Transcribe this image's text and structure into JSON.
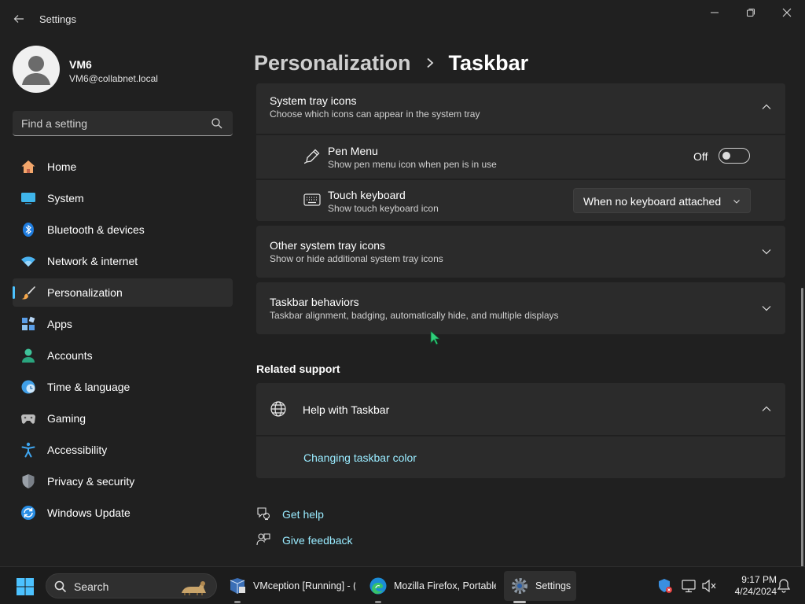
{
  "window": {
    "app_title": "Settings",
    "icons": {
      "back": "arrow-left-icon",
      "minimize": "minimize-icon",
      "maximize": "restore-icon",
      "close": "close-icon"
    }
  },
  "profile": {
    "name": "VM6",
    "email": "VM6@collabnet.local"
  },
  "search": {
    "placeholder": "Find a setting"
  },
  "nav": {
    "items": [
      {
        "label": "Home",
        "icon": "home-icon",
        "active": false
      },
      {
        "label": "System",
        "icon": "system-icon",
        "active": false
      },
      {
        "label": "Bluetooth & devices",
        "icon": "bluetooth-icon",
        "active": false
      },
      {
        "label": "Network & internet",
        "icon": "wifi-icon",
        "active": false
      },
      {
        "label": "Personalization",
        "icon": "brush-icon",
        "active": true
      },
      {
        "label": "Apps",
        "icon": "apps-icon",
        "active": false
      },
      {
        "label": "Accounts",
        "icon": "accounts-icon",
        "active": false
      },
      {
        "label": "Time & language",
        "icon": "clock-globe-icon",
        "active": false
      },
      {
        "label": "Gaming",
        "icon": "gamepad-icon",
        "active": false
      },
      {
        "label": "Accessibility",
        "icon": "accessibility-icon",
        "active": false
      },
      {
        "label": "Privacy & security",
        "icon": "shield-icon",
        "active": false
      },
      {
        "label": "Windows Update",
        "icon": "update-icon",
        "active": false
      }
    ]
  },
  "breadcrumb": {
    "parent": "Personalization",
    "current": "Taskbar"
  },
  "main": {
    "system_tray": {
      "title": "System tray icons",
      "subtitle": "Choose which icons can appear in the system tray",
      "pen_menu": {
        "title": "Pen Menu",
        "subtitle": "Show pen menu icon when pen is in use",
        "state_label": "Off",
        "on": false
      },
      "touch_keyboard": {
        "title": "Touch keyboard",
        "subtitle": "Show touch keyboard icon",
        "selected": "When no keyboard attached"
      }
    },
    "other_tray": {
      "title": "Other system tray icons",
      "subtitle": "Show or hide additional system tray icons"
    },
    "behaviors": {
      "title": "Taskbar behaviors",
      "subtitle": "Taskbar alignment, badging, automatically hide, and multiple displays"
    },
    "related_support": {
      "heading": "Related support",
      "help_title": "Help with Taskbar",
      "link": "Changing taskbar color"
    },
    "get_help": "Get help",
    "give_feedback": "Give feedback"
  },
  "taskbar": {
    "search_label": "Search",
    "apps": [
      {
        "label": "VMception [Running] - (",
        "icon": "virtualbox-icon"
      },
      {
        "label": "Mozilla Firefox, Portable",
        "icon": "edge-browser-icon"
      },
      {
        "label": "Settings",
        "icon": "settings-gear-icon"
      }
    ],
    "time": "9:17 PM",
    "date": "4/24/2024"
  },
  "colors": {
    "accent": "#4cc2ff",
    "link": "#99ebff",
    "background": "#202020",
    "card": "#2b2b2b"
  }
}
